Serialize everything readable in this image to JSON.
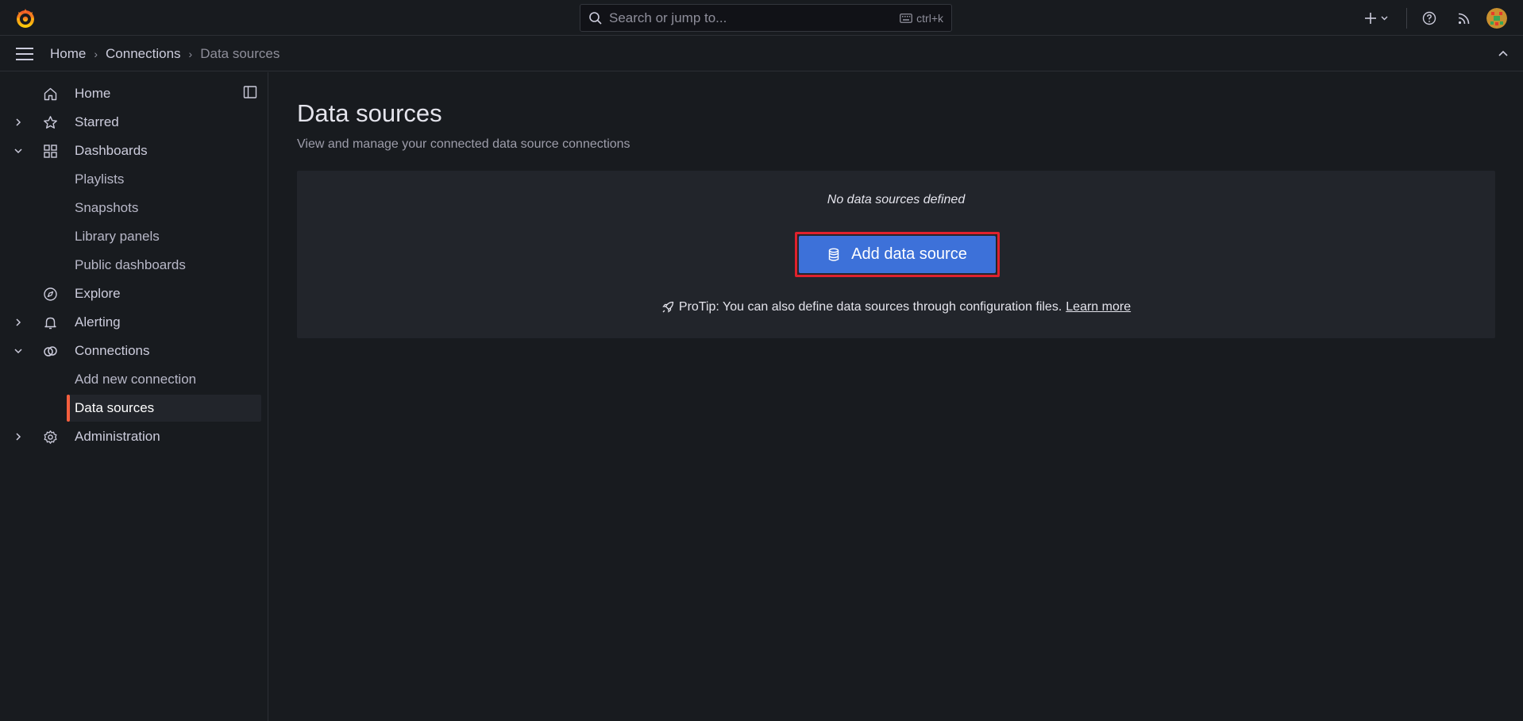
{
  "topbar": {
    "search_placeholder": "Search or jump to...",
    "shortcut": "ctrl+k"
  },
  "breadcrumb": {
    "items": [
      "Home",
      "Connections",
      "Data sources"
    ]
  },
  "sidebar": {
    "items": [
      {
        "label": "Home",
        "icon": "home-icon"
      },
      {
        "label": "Starred",
        "icon": "star-icon",
        "expandable": true
      },
      {
        "label": "Dashboards",
        "icon": "apps-icon",
        "expanded": true
      },
      {
        "label": "Playlists"
      },
      {
        "label": "Snapshots"
      },
      {
        "label": "Library panels"
      },
      {
        "label": "Public dashboards"
      },
      {
        "label": "Explore",
        "icon": "compass-icon"
      },
      {
        "label": "Alerting",
        "icon": "bell-icon",
        "expandable": true
      },
      {
        "label": "Connections",
        "icon": "link-icon",
        "expanded": true
      },
      {
        "label": "Add new connection"
      },
      {
        "label": "Data sources",
        "active": true
      },
      {
        "label": "Administration",
        "icon": "cog-icon",
        "expandable": true
      }
    ]
  },
  "main": {
    "title": "Data sources",
    "subtitle": "View and manage your connected data source connections",
    "empty_message": "No data sources defined",
    "add_button_label": "Add data source",
    "protip_text": "ProTip: You can also define data sources through configuration files.",
    "protip_link": "Learn more"
  },
  "colors": {
    "accent": "#f55f3e",
    "primary_button": "#3d71d9",
    "highlight_border": "#e0212d",
    "background": "#181b1f",
    "panel": "#22252b"
  }
}
